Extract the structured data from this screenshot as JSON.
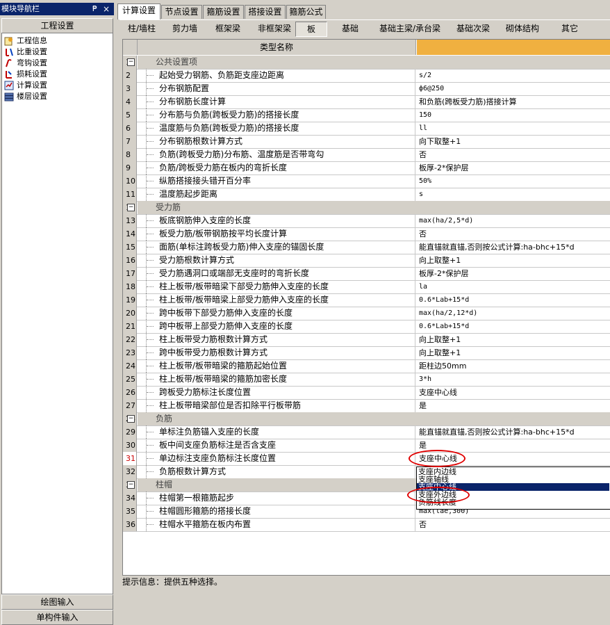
{
  "left": {
    "title": "模块导航栏",
    "pin": "₱",
    "close": "×",
    "section": "工程设置",
    "items": [
      {
        "label": "工程信息"
      },
      {
        "label": "比重设置"
      },
      {
        "label": "弯钩设置"
      },
      {
        "label": "损耗设置"
      },
      {
        "label": "计算设置"
      },
      {
        "label": "楼层设置"
      }
    ],
    "bottom1": "绘图输入",
    "bottom2": "单构件输入"
  },
  "tabs": [
    "计算设置",
    "节点设置",
    "箍筋设置",
    "搭接设置",
    "箍筋公式"
  ],
  "subtabs": [
    "柱/墙柱",
    "剪力墙",
    "框架梁",
    "非框架梁",
    "板",
    "基础",
    "基础主梁/承台梁",
    "基础次梁",
    "砌体结构",
    "其它"
  ],
  "grid": {
    "header": "类型名称",
    "rows": [
      {
        "n": "1",
        "name": "公共设置项",
        "val": "",
        "group": true
      },
      {
        "n": "2",
        "name": "起始受力钢筋、负筋距支座边距离",
        "val": "s/2"
      },
      {
        "n": "3",
        "name": "分布钢筋配置",
        "val": "ф6@250"
      },
      {
        "n": "4",
        "name": "分布钢筋长度计算",
        "val": "和负筋(跨板受力筋)搭接计算"
      },
      {
        "n": "5",
        "name": "分布筋与负筋(跨板受力筋)的搭接长度",
        "val": "150"
      },
      {
        "n": "6",
        "name": "温度筋与负筋(跨板受力筋)的搭接长度",
        "val": "ll"
      },
      {
        "n": "7",
        "name": "分布钢筋根数计算方式",
        "val": "向下取整+1"
      },
      {
        "n": "8",
        "name": "负筋(跨板受力筋)分布筋、温度筋是否带弯勾",
        "val": "否"
      },
      {
        "n": "9",
        "name": "负筋/跨板受力筋在板内的弯折长度",
        "val": "板厚-2*保护层"
      },
      {
        "n": "10",
        "name": "纵筋搭接接头错开百分率",
        "val": "50%"
      },
      {
        "n": "11",
        "name": "温度筋起步距离",
        "val": "s"
      },
      {
        "n": "12",
        "name": "受力筋",
        "val": "",
        "group": true
      },
      {
        "n": "13",
        "name": "板底钢筋伸入支座的长度",
        "val": "max(ha/2,5*d)"
      },
      {
        "n": "14",
        "name": "板受力筋/板带钢筋按平均长度计算",
        "val": "否"
      },
      {
        "n": "15",
        "name": "面筋(单标注跨板受力筋)伸入支座的锚固长度",
        "val": "能直锚就直锚,否则按公式计算:ha-bhc+15*d"
      },
      {
        "n": "16",
        "name": "受力筋根数计算方式",
        "val": "向上取整+1"
      },
      {
        "n": "17",
        "name": "受力筋遇洞口或端部无支座时的弯折长度",
        "val": "板厚-2*保护层"
      },
      {
        "n": "18",
        "name": "柱上板带/板带暗梁下部受力筋伸入支座的长度",
        "val": "la"
      },
      {
        "n": "19",
        "name": "柱上板带/板带暗梁上部受力筋伸入支座的长度",
        "val": "0.6*Lab+15*d"
      },
      {
        "n": "20",
        "name": "跨中板带下部受力筋伸入支座的长度",
        "val": "max(ha/2,12*d)"
      },
      {
        "n": "21",
        "name": "跨中板带上部受力筋伸入支座的长度",
        "val": "0.6*Lab+15*d"
      },
      {
        "n": "22",
        "name": "柱上板带受力筋根数计算方式",
        "val": "向上取整+1"
      },
      {
        "n": "23",
        "name": "跨中板带受力筋根数计算方式",
        "val": "向上取整+1"
      },
      {
        "n": "24",
        "name": "柱上板带/板带暗梁的箍筋起始位置",
        "val": "距柱边50mm"
      },
      {
        "n": "25",
        "name": "柱上板带/板带暗梁的箍筋加密长度",
        "val": "3*h"
      },
      {
        "n": "26",
        "name": "跨板受力筋标注长度位置",
        "val": "支座中心线"
      },
      {
        "n": "27",
        "name": "柱上板带暗梁部位是否扣除平行板带筋",
        "val": "是"
      },
      {
        "n": "28",
        "name": "负筋",
        "val": "",
        "group": true
      },
      {
        "n": "29",
        "name": "单标注负筋锚入支座的长度",
        "val": "能直锚就直锚,否则按公式计算:ha-bhc+15*d"
      },
      {
        "n": "30",
        "name": "板中间支座负筋标注是否含支座",
        "val": "是"
      },
      {
        "n": "31",
        "name": "单边标注支座负筋标注长度位置",
        "val": "支座中心线",
        "sel": true
      },
      {
        "n": "32",
        "name": "负筋根数计算方式",
        "val": ""
      },
      {
        "n": "33",
        "name": "柱帽",
        "val": "",
        "group": true
      },
      {
        "n": "34",
        "name": "柱帽第一根箍筋起步",
        "val": ""
      },
      {
        "n": "35",
        "name": "柱帽圆形箍筋的搭接长度",
        "val": "max(lae,300)"
      },
      {
        "n": "36",
        "name": "柱帽水平箍筋在板内布置",
        "val": "否"
      }
    ]
  },
  "dropdown": {
    "options": [
      "支座内边线",
      "支座轴线",
      "支座中心线",
      "支座外边线",
      "负筋线长度"
    ],
    "selected_index": 2
  },
  "hint": "提示信息：提供五种选择。",
  "colors": {
    "title_bar": "#0a246a",
    "highlight": "#e00000",
    "selection": "#0a246a",
    "header_bg": "#f0b040"
  }
}
